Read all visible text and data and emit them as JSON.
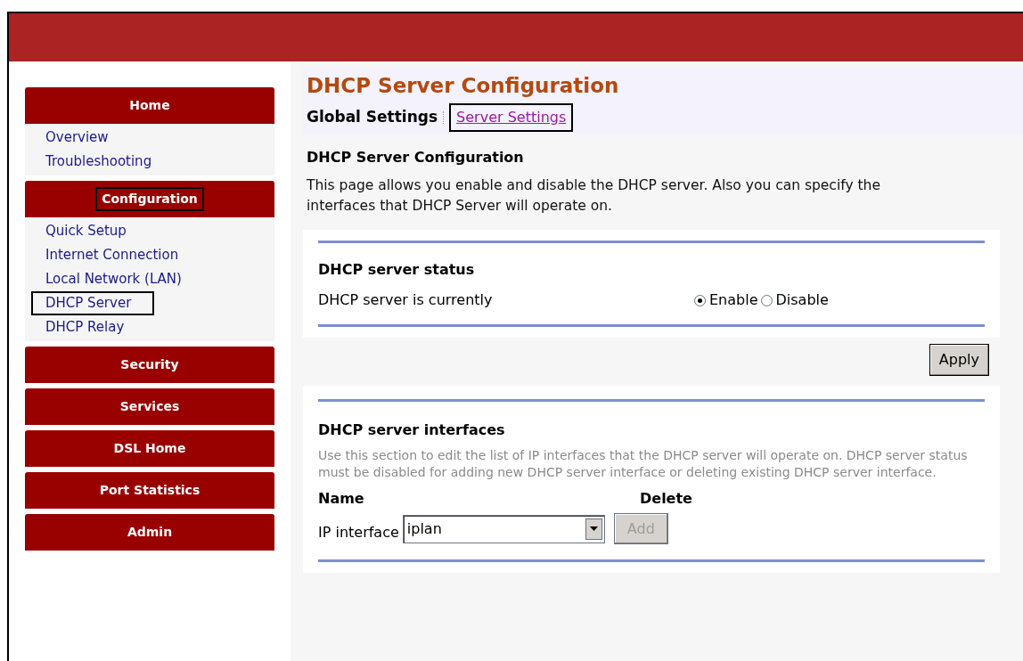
{
  "sidebar": {
    "groups": [
      {
        "label": "Home",
        "highlighted": false,
        "items": [
          {
            "label": "Overview",
            "highlighted": false
          },
          {
            "label": "Troubleshooting",
            "highlighted": false
          }
        ]
      },
      {
        "label": "Configuration",
        "highlighted": true,
        "items": [
          {
            "label": "Quick Setup",
            "highlighted": false
          },
          {
            "label": "Internet Connection",
            "highlighted": false
          },
          {
            "label": "Local Network (LAN)",
            "highlighted": false
          },
          {
            "label": "DHCP Server",
            "highlighted": true
          },
          {
            "label": "DHCP Relay",
            "highlighted": false
          }
        ]
      },
      {
        "label": "Security",
        "highlighted": false
      },
      {
        "label": "Services",
        "highlighted": false
      },
      {
        "label": "DSL Home",
        "highlighted": false
      },
      {
        "label": "Port Statistics",
        "highlighted": false
      },
      {
        "label": "Admin",
        "highlighted": false
      }
    ]
  },
  "page": {
    "title": "DHCP Server Configuration",
    "tabs": [
      {
        "label": "Global Settings",
        "selected": true,
        "highlighted": false
      },
      {
        "label": "Server Settings",
        "selected": false,
        "highlighted": true
      }
    ],
    "heading": "DHCP Server Configuration",
    "intro": "This page allows you enable and disable the DHCP server. Also you can specify the interfaces that DHCP Server will operate on.",
    "status_section": {
      "title": "DHCP server status",
      "label": "DHCP server is currently",
      "options": [
        {
          "label": "Enable",
          "selected": true
        },
        {
          "label": "Disable",
          "selected": false
        }
      ]
    },
    "apply_button": "Apply",
    "interfaces_section": {
      "title": "DHCP server interfaces",
      "description": "Use this section to edit the list of IP interfaces that the DHCP server will operate on. DHCP server status must be disabled for adding new DHCP server interface or deleting existing DHCP server interface.",
      "columns": [
        "Name",
        "Delete"
      ],
      "field_label": "IP interface",
      "select_value": "iplan",
      "add_button": {
        "label": "Add",
        "disabled": true
      }
    }
  }
}
